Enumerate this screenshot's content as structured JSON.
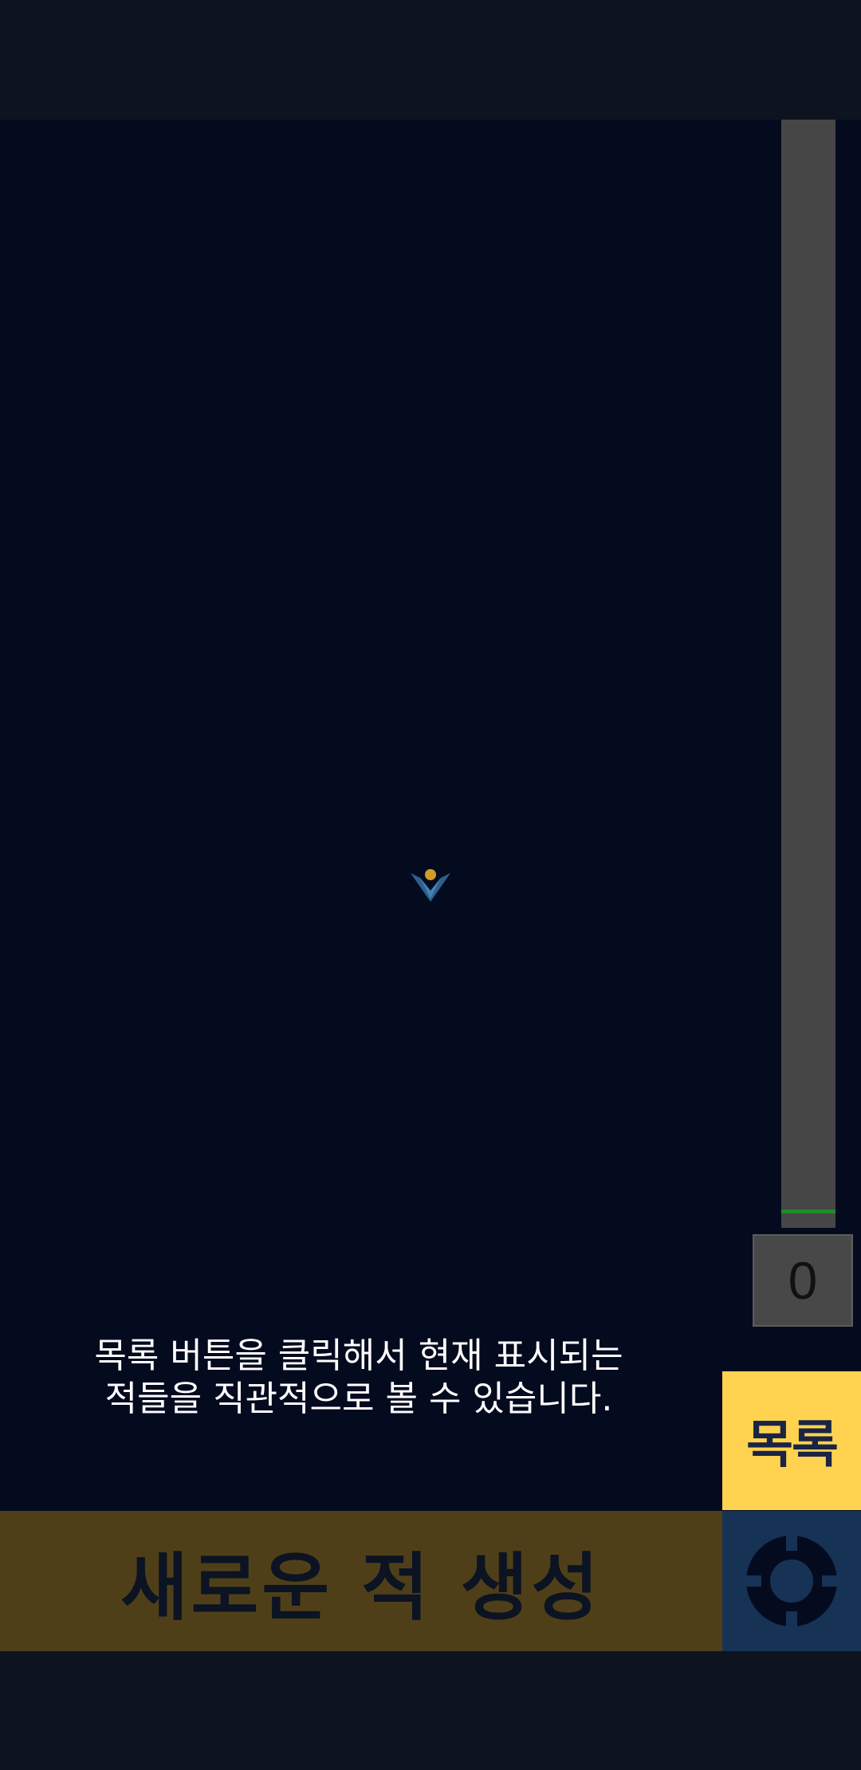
{
  "score": {
    "value": "0"
  },
  "gauge": {
    "level": 0.0
  },
  "hint": {
    "text": "목록 버튼을 클릭해서 현재 표시되는\n적들을 직관적으로 볼 수 있습니다."
  },
  "buttons": {
    "list_label": "목록",
    "spawn_label": "새로운 적 생성",
    "settings_icon": "gear-icon"
  },
  "colors": {
    "field_background": "#050b1f",
    "list_button": "#ffd34f",
    "spawn_button": "#4f3f19",
    "settings_button": "#163356",
    "gauge_marker": "#1f8a2a"
  }
}
